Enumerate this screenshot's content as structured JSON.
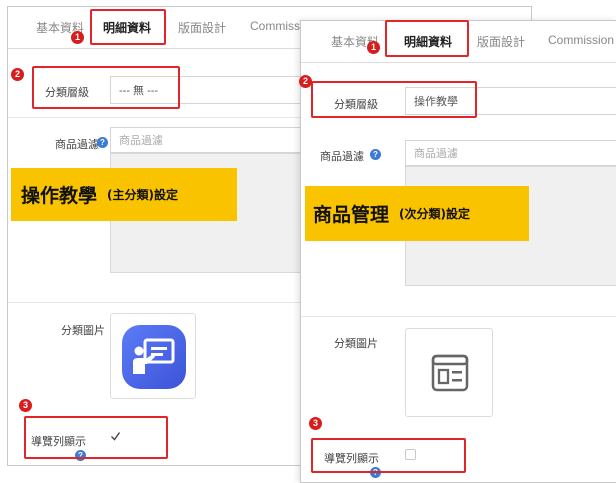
{
  "left_panel": {
    "tabs": [
      "基本資料",
      "明細資料",
      "版面設計",
      "Commissi"
    ],
    "active_tab_index": 1,
    "category_level": {
      "label": "分類層級",
      "value": "--- 無 ---"
    },
    "product_filter": {
      "label": "商品過濾",
      "placeholder": "商品過濾"
    },
    "category_image": {
      "label": "分類圖片",
      "icon": "presentation-teaching-icon",
      "icon_color": "#4a6cf0"
    },
    "nav_display": {
      "label": "導覽列顯示",
      "checked": true
    },
    "banner": {
      "main": "操作教學",
      "sub": "(主分類)設定"
    }
  },
  "right_panel": {
    "tabs": [
      "基本資料",
      "明細資料",
      "版面設計",
      "Commission"
    ],
    "active_tab_index": 1,
    "category_level": {
      "label": "分類層級",
      "value": "操作教學"
    },
    "product_filter": {
      "label": "商品過濾",
      "placeholder": "商品過濾"
    },
    "category_image": {
      "label": "分類圖片",
      "icon": "document-layout-icon"
    },
    "nav_display": {
      "label": "導覽列顯示",
      "checked": false
    },
    "banner": {
      "main": "商品管理",
      "sub": "(次分類)設定"
    }
  },
  "badges": [
    "1",
    "2",
    "3"
  ],
  "colors": {
    "highlight": "#e0262a",
    "badge": "#d71d1d",
    "banner": "#f9c300",
    "help": "#3a7bd5"
  }
}
